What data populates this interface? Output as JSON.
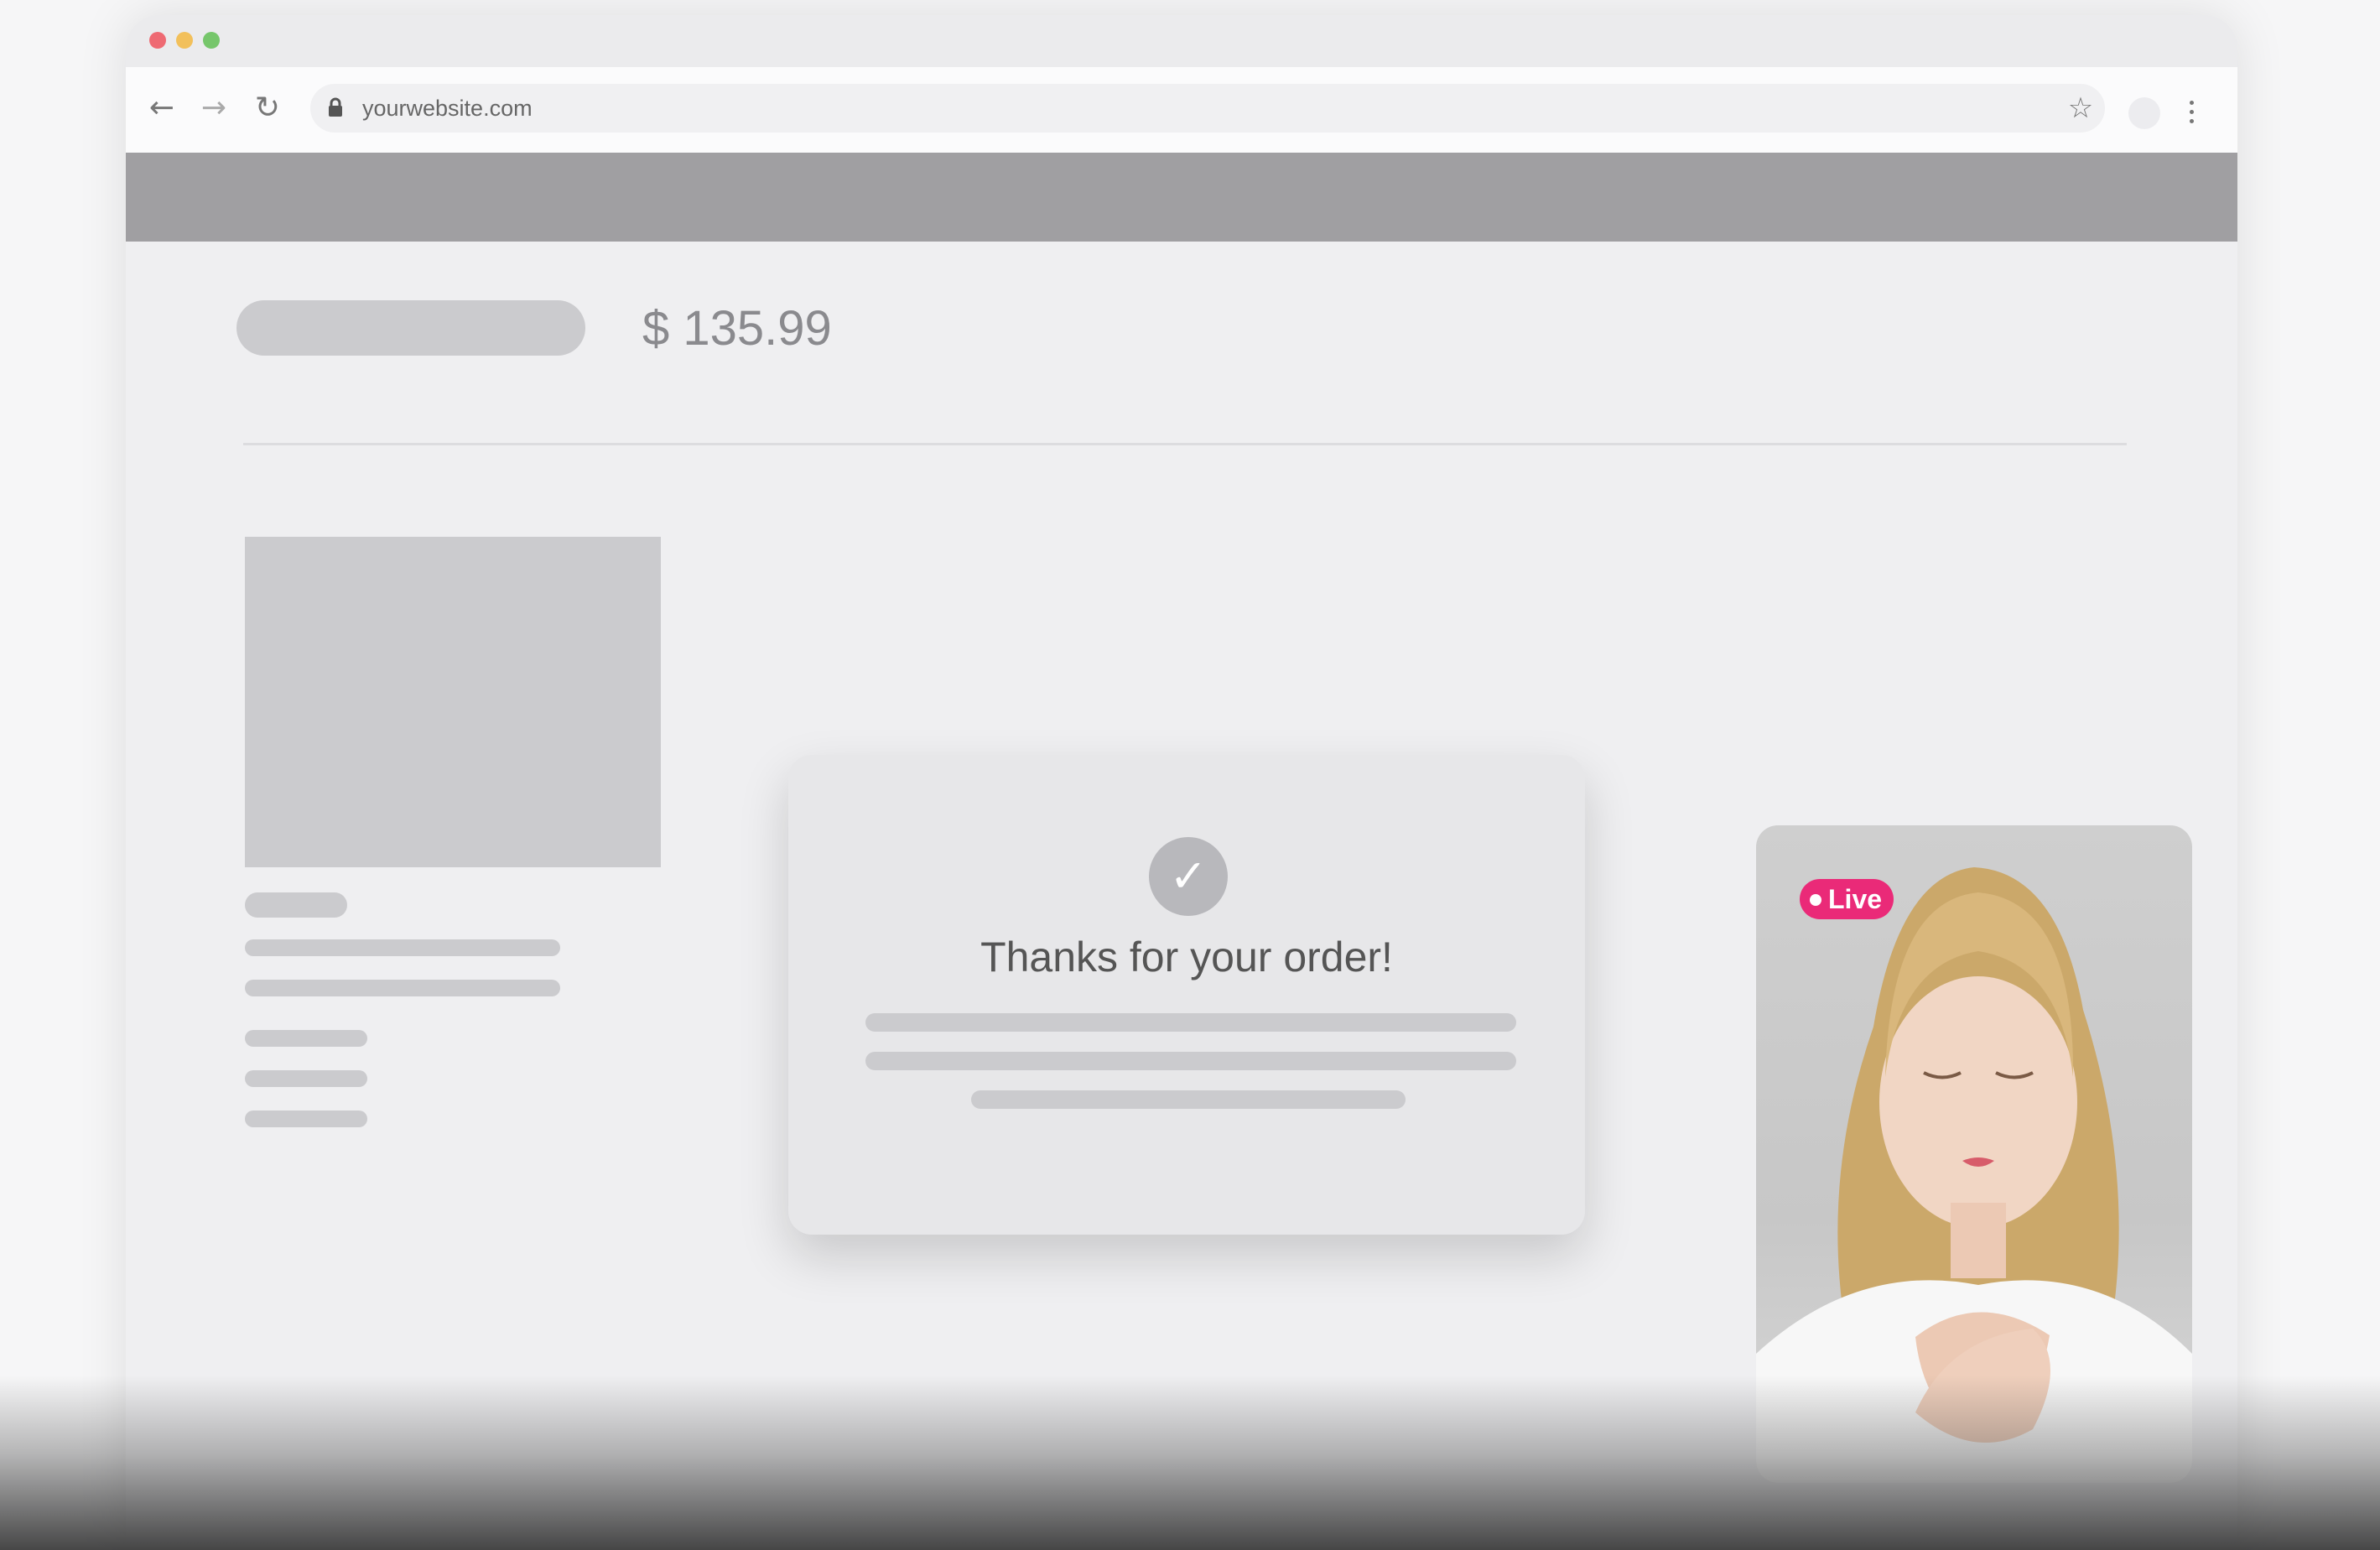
{
  "browser": {
    "url": "yourwebsite.com",
    "icons": {
      "back": "arrow-left-icon",
      "forward": "arrow-right-icon",
      "reload": "reload-icon",
      "lock": "lock-icon",
      "bookmark": "star-icon",
      "menu": "kebab-menu-icon"
    }
  },
  "product": {
    "price": "$ 135.99"
  },
  "confirmation": {
    "title": "Thanks for your order!"
  },
  "live_video": {
    "badge": "Live"
  },
  "colors": {
    "header_band": "#a09fa2",
    "live_badge": "#ea2a78",
    "placeholder": "#cbcbce",
    "check_circle": "#b8b8bc"
  }
}
